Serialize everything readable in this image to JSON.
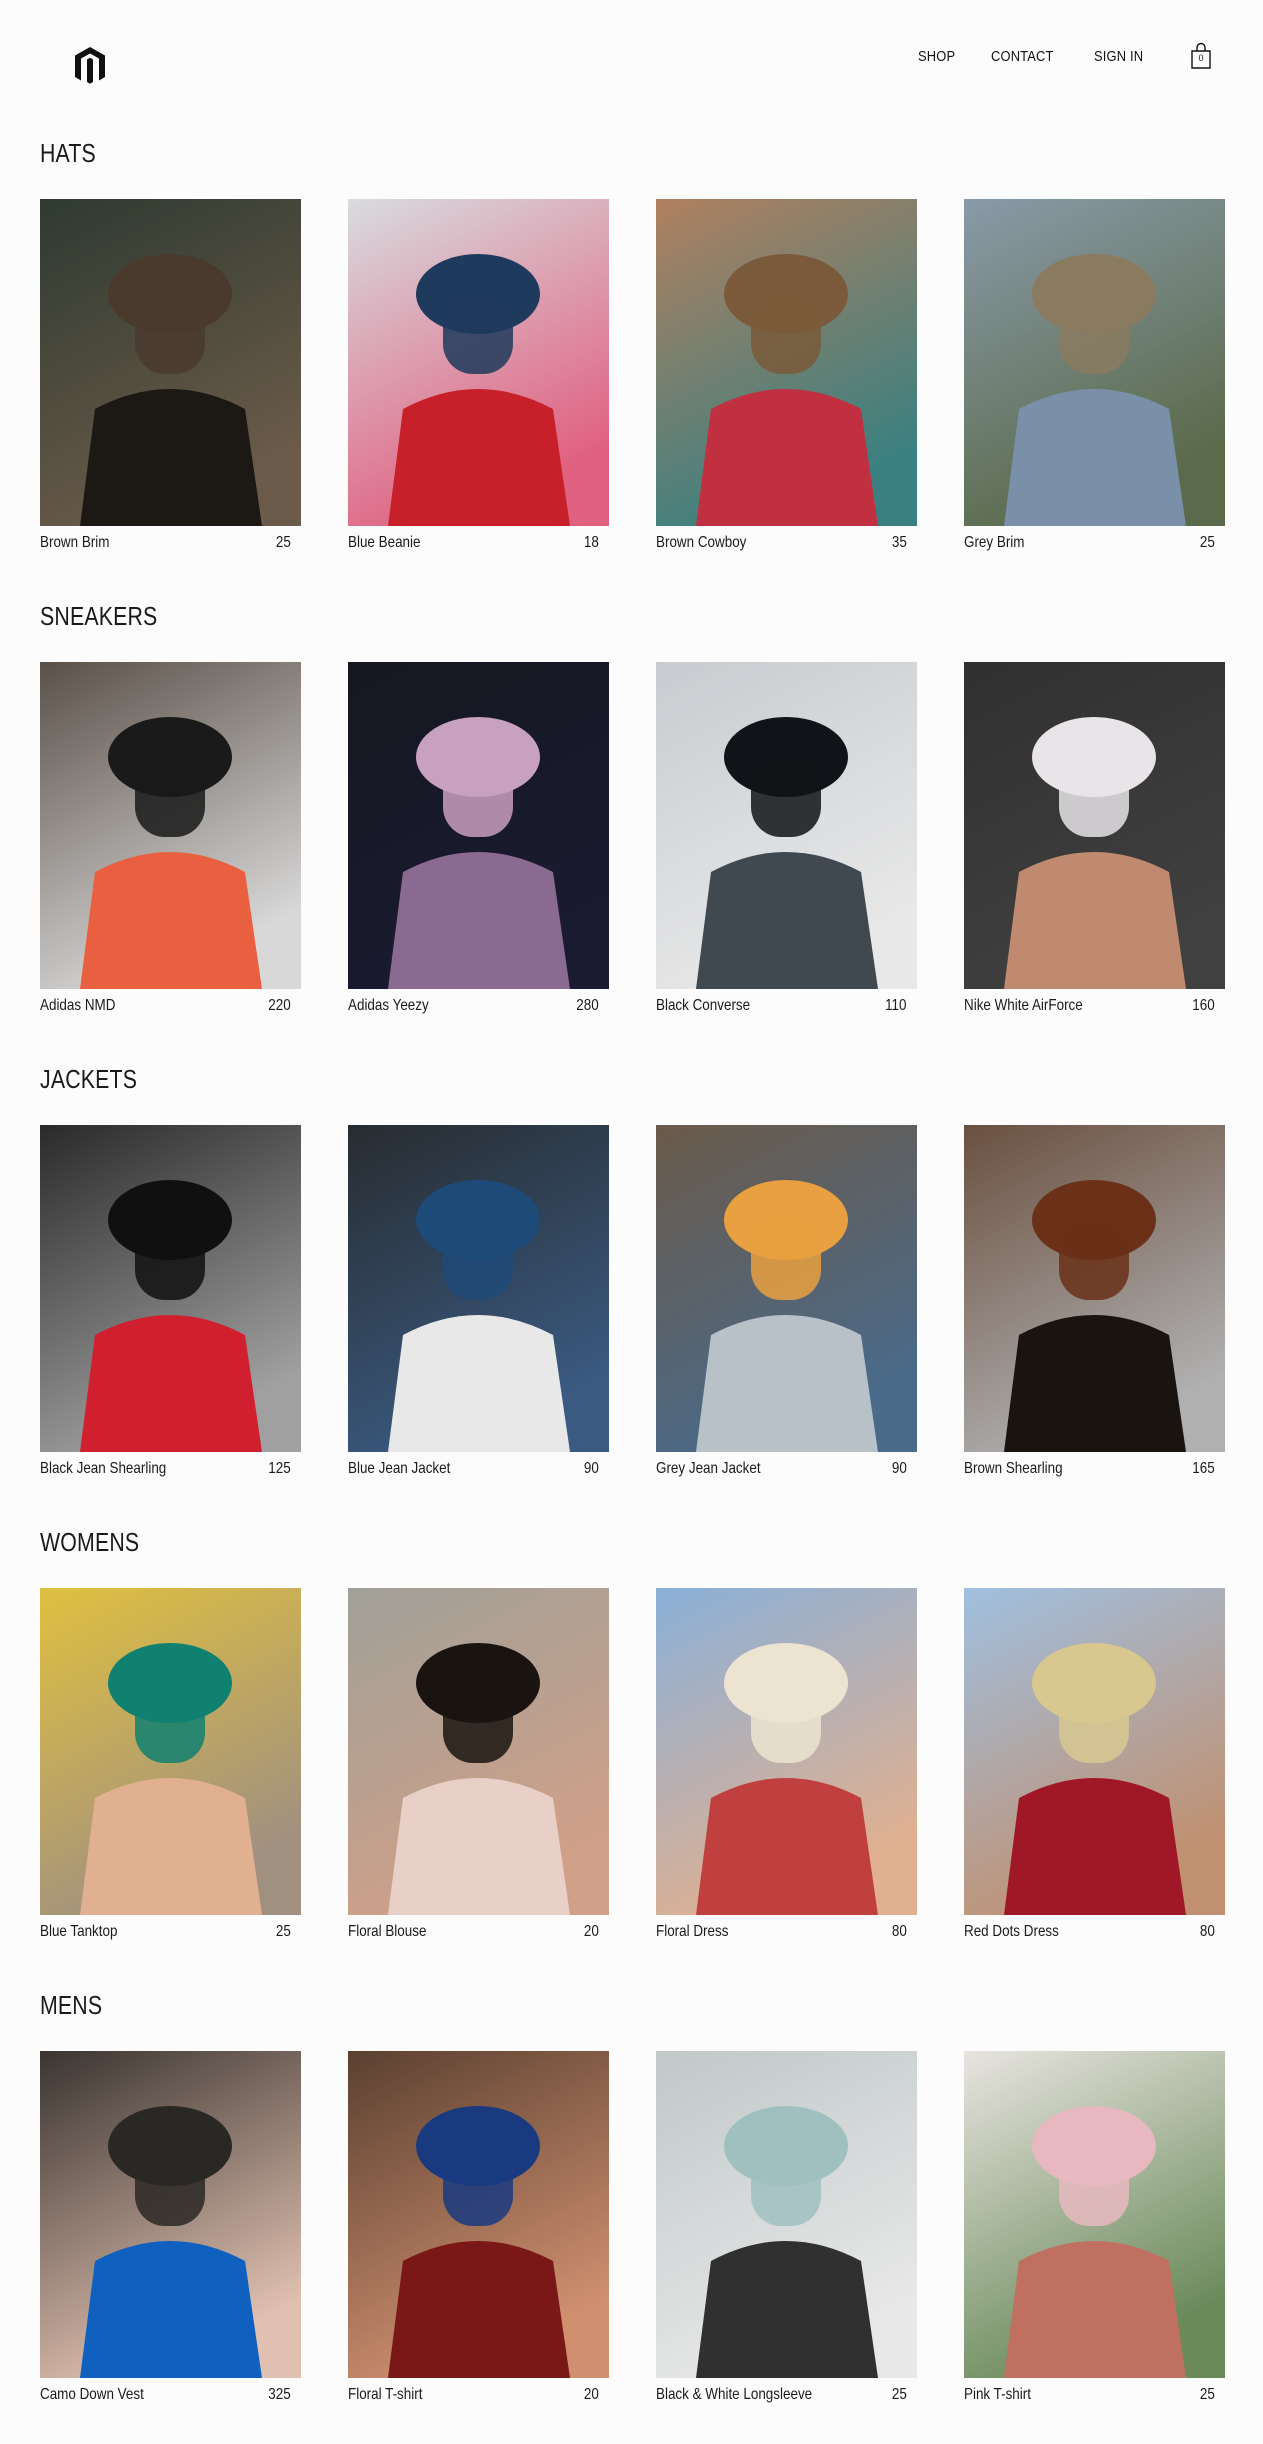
{
  "header": {
    "nav": [
      {
        "label": "SHOP"
      },
      {
        "label": "CONTACT"
      },
      {
        "label": "SIGN IN"
      }
    ],
    "cart_count": "0"
  },
  "collections": [
    {
      "title": "HATS",
      "items": [
        {
          "name": "Brown Brim",
          "price": "25"
        },
        {
          "name": "Blue Beanie",
          "price": "18"
        },
        {
          "name": "Brown Cowboy",
          "price": "35"
        },
        {
          "name": "Grey Brim",
          "price": "25"
        }
      ]
    },
    {
      "title": "SNEAKERS",
      "items": [
        {
          "name": "Adidas NMD",
          "price": "220"
        },
        {
          "name": "Adidas Yeezy",
          "price": "280"
        },
        {
          "name": "Black Converse",
          "price": "110"
        },
        {
          "name": "Nike White AirForce",
          "price": "160"
        }
      ]
    },
    {
      "title": "JACKETS",
      "items": [
        {
          "name": "Black Jean Shearling",
          "price": "125"
        },
        {
          "name": "Blue Jean Jacket",
          "price": "90"
        },
        {
          "name": "Grey Jean Jacket",
          "price": "90"
        },
        {
          "name": "Brown Shearling",
          "price": "165"
        }
      ]
    },
    {
      "title": "WOMENS",
      "items": [
        {
          "name": "Blue Tanktop",
          "price": "25"
        },
        {
          "name": "Floral Blouse",
          "price": "20"
        },
        {
          "name": "Floral Dress",
          "price": "80"
        },
        {
          "name": "Red Dots Dress",
          "price": "80"
        }
      ]
    },
    {
      "title": "MENS",
      "items": [
        {
          "name": "Camo Down Vest",
          "price": "325"
        },
        {
          "name": "Floral T-shirt",
          "price": "20"
        },
        {
          "name": "Black & White Longsleeve",
          "price": "25"
        },
        {
          "name": "Pink T-shirt",
          "price": "25"
        }
      ]
    }
  ],
  "photo_palettes": [
    [
      "#2e3a30",
      "#4a3a2e",
      "#1c1814",
      "#6b5b4a"
    ],
    [
      "#d8dcdf",
      "#1e3a5c",
      "#c8202a",
      "#e06080"
    ],
    [
      "#b08060",
      "#7a5a3a",
      "#c03040",
      "#3a8080"
    ],
    [
      "#8a9aa8",
      "#8a7a60",
      "#7a90a8",
      "#5a6a4a"
    ],
    [
      "#5a5048",
      "#1a1a1a",
      "#e86040",
      "#d8d8d8"
    ],
    [
      "#151820",
      "#c8a0c0",
      "#8a6a90",
      "#1a1a30"
    ],
    [
      "#c8ccd0",
      "#101418",
      "#404850",
      "#e8e8e8"
    ],
    [
      "#303030",
      "#e8e4e8",
      "#c08a70",
      "#404040"
    ],
    [
      "#2a2a2a",
      "#101010",
      "#d02030",
      "#a0a0a0"
    ],
    [
      "#282c30",
      "#1e4a78",
      "#e8e8e8",
      "#3a5a80"
    ],
    [
      "#6a5a4a",
      "#e8a040",
      "#b8c0c8",
      "#4a6a8a"
    ],
    [
      "#6a5040",
      "#6a3018",
      "#1a1410",
      "#b0b0b0"
    ],
    [
      "#e0c040",
      "#108070",
      "#e0b090",
      "#a09080"
    ],
    [
      "#a0a098",
      "#1a1410",
      "#e8d0c8",
      "#d0a088"
    ],
    [
      "#8ab0d8",
      "#ece4d0",
      "#c04040",
      "#e0b090"
    ],
    [
      "#a0c0e0",
      "#d8c890",
      "#a01828",
      "#c09070"
    ],
    [
      "#3a3430",
      "#2a2824",
      "#1060c0",
      "#e0c0b0"
    ],
    [
      "#5a4030",
      "#1a3a80",
      "#7a1818",
      "#d09070"
    ],
    [
      "#c0c8c8",
      "#a0c0c0",
      "#303030",
      "#e8e8e8"
    ],
    [
      "#e8e4e0",
      "#e8b8c0",
      "#c07060",
      "#6a8a5a"
    ]
  ]
}
